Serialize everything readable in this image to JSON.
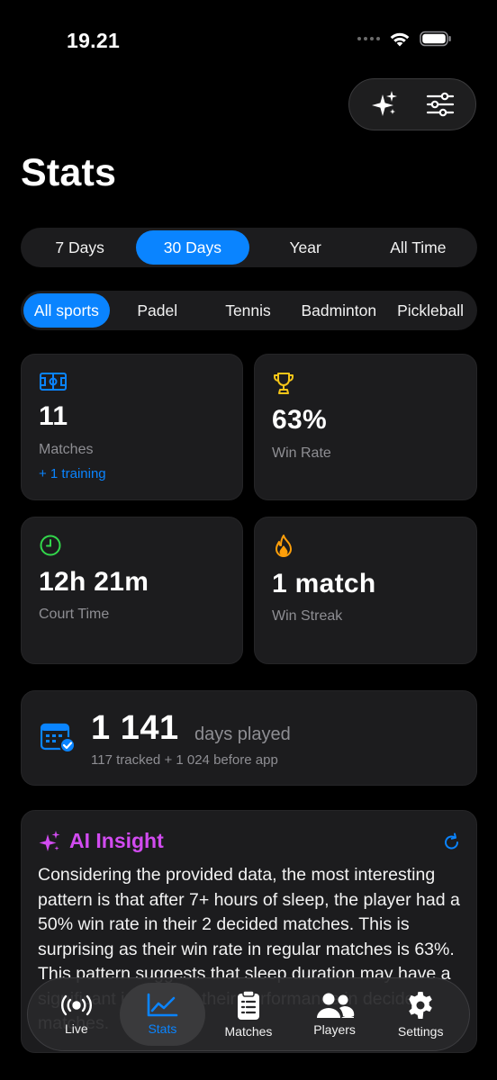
{
  "status_bar": {
    "time": "19.21"
  },
  "header": {
    "title": "Stats"
  },
  "time_ranges": {
    "items": [
      "7 Days",
      "30 Days",
      "Year",
      "All Time"
    ],
    "selected": "30 Days"
  },
  "sports": {
    "items": [
      "All sports",
      "Padel",
      "Tennis",
      "Badminton",
      "Pickleball"
    ],
    "selected": "All sports"
  },
  "cards": {
    "matches": {
      "value": "11",
      "label": "Matches",
      "sub": "+ 1 training",
      "icon": "court-icon"
    },
    "win_rate": {
      "value": "63%",
      "label": "Win Rate",
      "icon": "trophy-icon"
    },
    "court_time": {
      "value": "12h 21m",
      "label": "Court Time",
      "icon": "clock-icon"
    },
    "win_streak": {
      "value": "1 match",
      "label": "Win Streak",
      "icon": "flame-icon"
    }
  },
  "days_played": {
    "value": "1 141",
    "label": "days played",
    "sub": "117 tracked + 1 024 before app",
    "icon": "calendar-check-icon"
  },
  "ai_insight": {
    "title": "AI Insight",
    "text": "Considering the provided data, the most interesting pattern is that after 7+ hours of sleep, the player had a 50% win rate in their 2 decided matches. This is surprising as their win rate in regular matches is 63%. This pattern suggests that sleep duration may have a significant impact on their performance in decided matches."
  },
  "tab_bar": {
    "tabs": [
      {
        "label": "Live",
        "icon": "live-broadcast-icon"
      },
      {
        "label": "Stats",
        "icon": "chart-line-icon"
      },
      {
        "label": "Matches",
        "icon": "clipboard-icon"
      },
      {
        "label": "Players",
        "icon": "people-icon"
      },
      {
        "label": "Settings",
        "icon": "gear-icon"
      }
    ],
    "selected": "Stats"
  },
  "colors": {
    "accent": "#0a84ff",
    "ai_purple": "#d14bf0",
    "trophy_yellow": "#f5c518",
    "clock_green": "#32d74b",
    "flame_orange": "#ff9f0a",
    "card_bg": "#1c1c1e"
  }
}
